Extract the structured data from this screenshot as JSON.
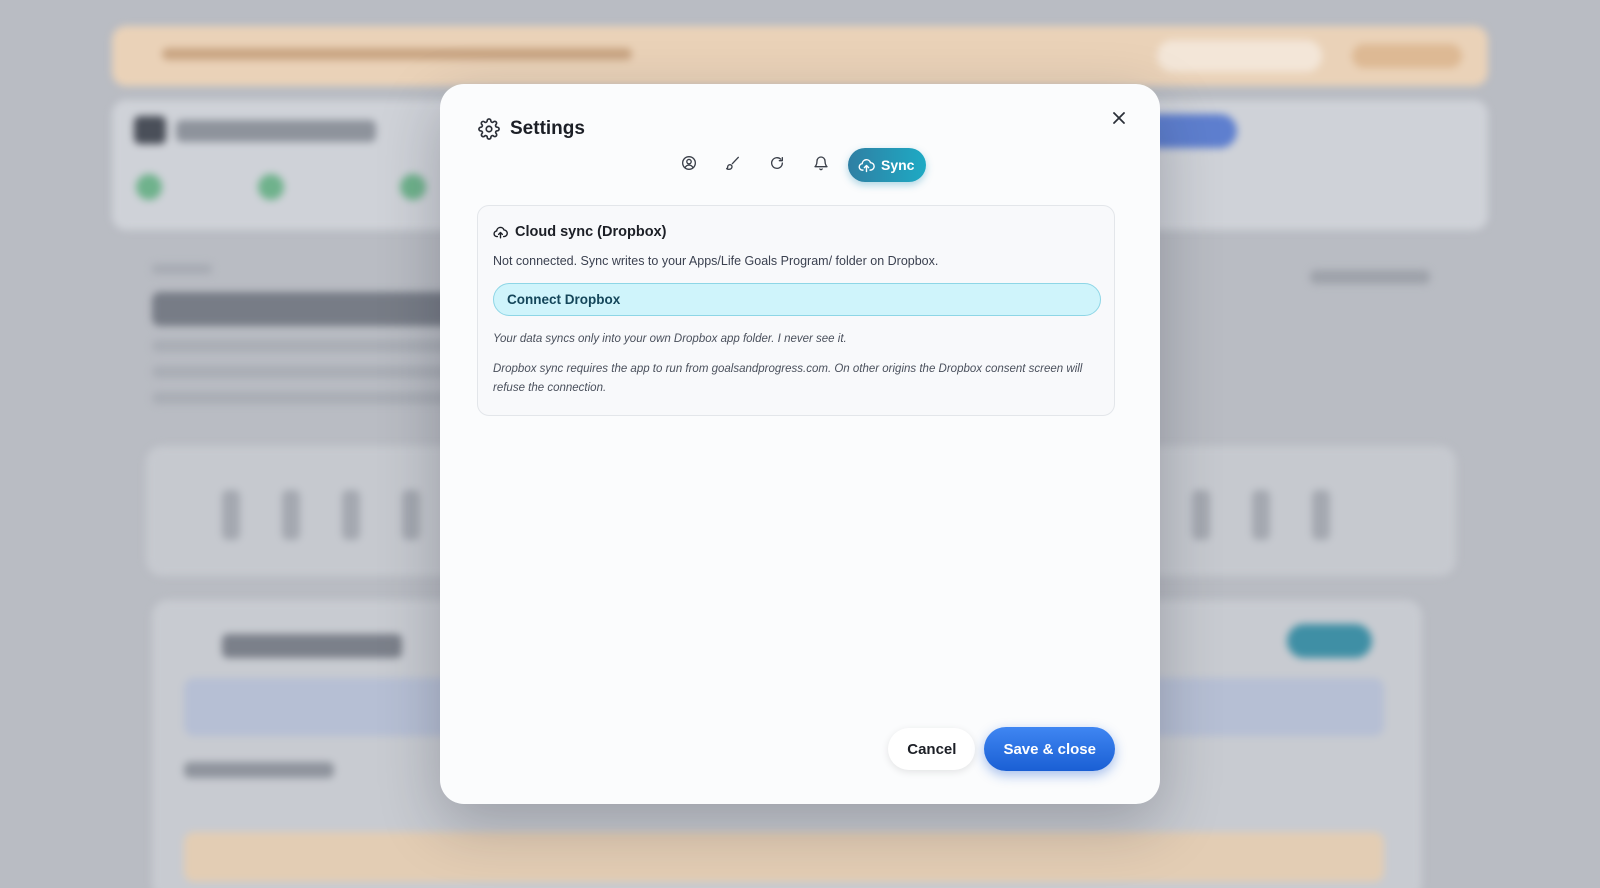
{
  "dialog": {
    "title": "Settings",
    "icon": "gear-icon",
    "close_icon": "close-icon"
  },
  "tabs": [
    {
      "name": "profile",
      "icon": "user-circle-icon",
      "label": "",
      "active": false
    },
    {
      "name": "appearance",
      "icon": "brush-icon",
      "label": "",
      "active": false
    },
    {
      "name": "reset",
      "icon": "refresh-icon",
      "label": "",
      "active": false
    },
    {
      "name": "notifications",
      "icon": "bell-icon",
      "label": "",
      "active": false
    },
    {
      "name": "sync",
      "icon": "cloud-upload-icon",
      "label": "Sync",
      "active": true
    }
  ],
  "sync_panel": {
    "title": "Cloud sync (Dropbox)",
    "status": "Not connected. Sync writes to your Apps/Life Goals Program/ folder on Dropbox.",
    "connect_label": "Connect Dropbox",
    "note_privacy": "Your data syncs only into your own Dropbox app folder. I never see it.",
    "note_origin": "Dropbox sync requires the app to run from goalsandprogress.com. On other origins the Dropbox consent screen will refuse the connection."
  },
  "footer": {
    "cancel_label": "Cancel",
    "save_label": "Save & close"
  },
  "colors": {
    "accent": "#1a5fd4",
    "sync_tab": "#1eaac4",
    "connect_bg": "#cff4fb"
  }
}
